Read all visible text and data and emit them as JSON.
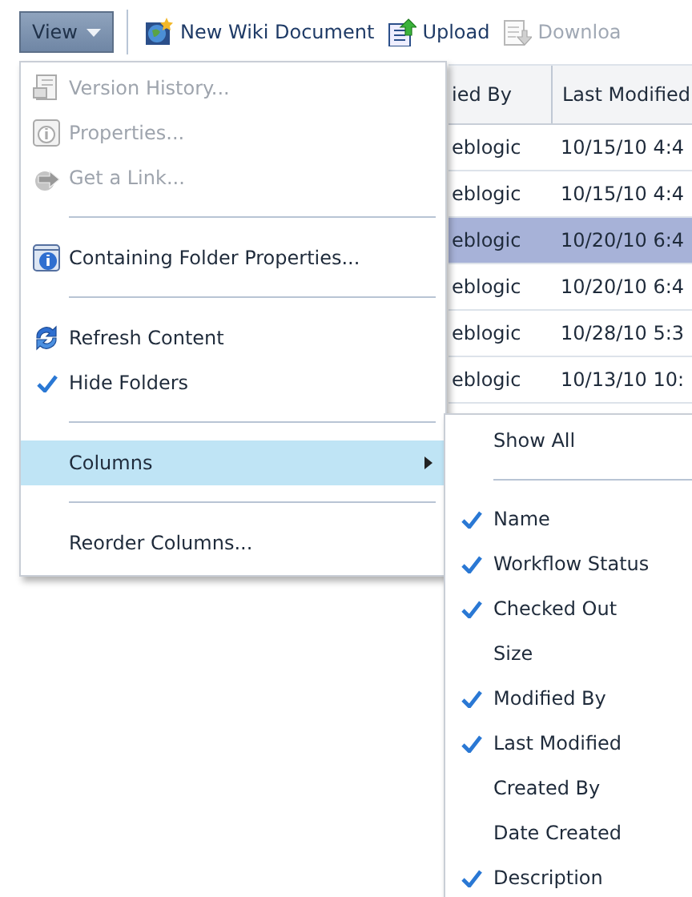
{
  "toolbar": {
    "view_button": {
      "label": "View"
    },
    "items": [
      {
        "label": "New Wiki Document",
        "disabled": false
      },
      {
        "label": "Upload",
        "disabled": false
      },
      {
        "label": "Downloa",
        "disabled": true
      }
    ]
  },
  "table": {
    "columns": [
      "ied By",
      "Last Modified"
    ],
    "rows": [
      {
        "cells": [
          "eblogic",
          "10/15/10 4:4"
        ],
        "selected": false
      },
      {
        "cells": [
          "eblogic",
          "10/15/10 4:4"
        ],
        "selected": false
      },
      {
        "cells": [
          "eblogic",
          "10/20/10 6:4"
        ],
        "selected": true
      },
      {
        "cells": [
          "eblogic",
          "10/20/10 6:4"
        ],
        "selected": false
      },
      {
        "cells": [
          "eblogic",
          "10/28/10 5:3"
        ],
        "selected": false
      },
      {
        "cells": [
          "eblogic",
          "10/13/10 10:"
        ],
        "selected": false
      }
    ]
  },
  "menu": {
    "items": [
      {
        "kind": "icon",
        "label": "Version History...",
        "disabled": true
      },
      {
        "kind": "icon",
        "label": "Properties...",
        "disabled": true
      },
      {
        "kind": "icon",
        "label": "Get a Link...",
        "disabled": true
      },
      {
        "kind": "separator"
      },
      {
        "kind": "icon",
        "label": "Containing Folder Properties...",
        "disabled": false
      },
      {
        "kind": "separator"
      },
      {
        "kind": "icon",
        "label": "Refresh Content",
        "disabled": false
      },
      {
        "kind": "check",
        "label": "Hide Folders",
        "checked": true
      },
      {
        "kind": "separator"
      },
      {
        "kind": "submenu",
        "label": "Columns",
        "expanded": true
      },
      {
        "kind": "separator"
      },
      {
        "kind": "plain",
        "label": "Reorder Columns..."
      }
    ]
  },
  "submenu": {
    "items": [
      {
        "kind": "plain",
        "label": "Show All"
      },
      {
        "kind": "separator"
      },
      {
        "kind": "check",
        "label": "Name",
        "checked": true
      },
      {
        "kind": "check",
        "label": "Workflow Status",
        "checked": true
      },
      {
        "kind": "check",
        "label": "Checked Out",
        "checked": true
      },
      {
        "kind": "check",
        "label": "Size",
        "checked": false
      },
      {
        "kind": "check",
        "label": "Modified By",
        "checked": true
      },
      {
        "kind": "check",
        "label": "Last Modified",
        "checked": true
      },
      {
        "kind": "check",
        "label": "Created By",
        "checked": false
      },
      {
        "kind": "check",
        "label": "Date Created",
        "checked": false
      },
      {
        "kind": "check",
        "label": "Description",
        "checked": true
      }
    ]
  }
}
